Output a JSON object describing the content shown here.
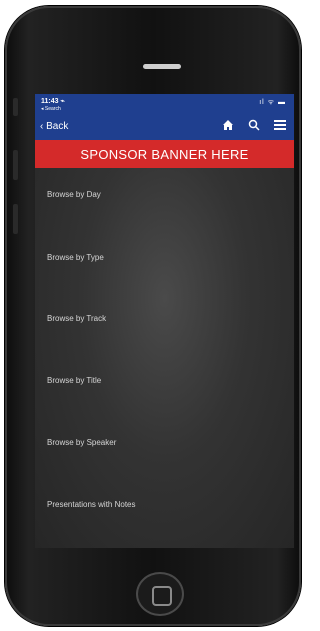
{
  "status_bar": {
    "time": "11:43 ⌁",
    "back_to_app": "◂ Search",
    "indicators": "ıl ᯤ ▬"
  },
  "nav": {
    "back_label": "Back",
    "home_icon": "home-icon",
    "search_icon": "search-icon",
    "menu_icon": "menu-icon"
  },
  "banner": {
    "text": "SPONSOR BANNER HERE"
  },
  "menu": {
    "items": [
      {
        "label": "Browse by Day"
      },
      {
        "label": "Browse by Type"
      },
      {
        "label": "Browse by Track"
      },
      {
        "label": "Browse by Title"
      },
      {
        "label": "Browse by Speaker"
      },
      {
        "label": "Presentations with Notes"
      }
    ]
  }
}
